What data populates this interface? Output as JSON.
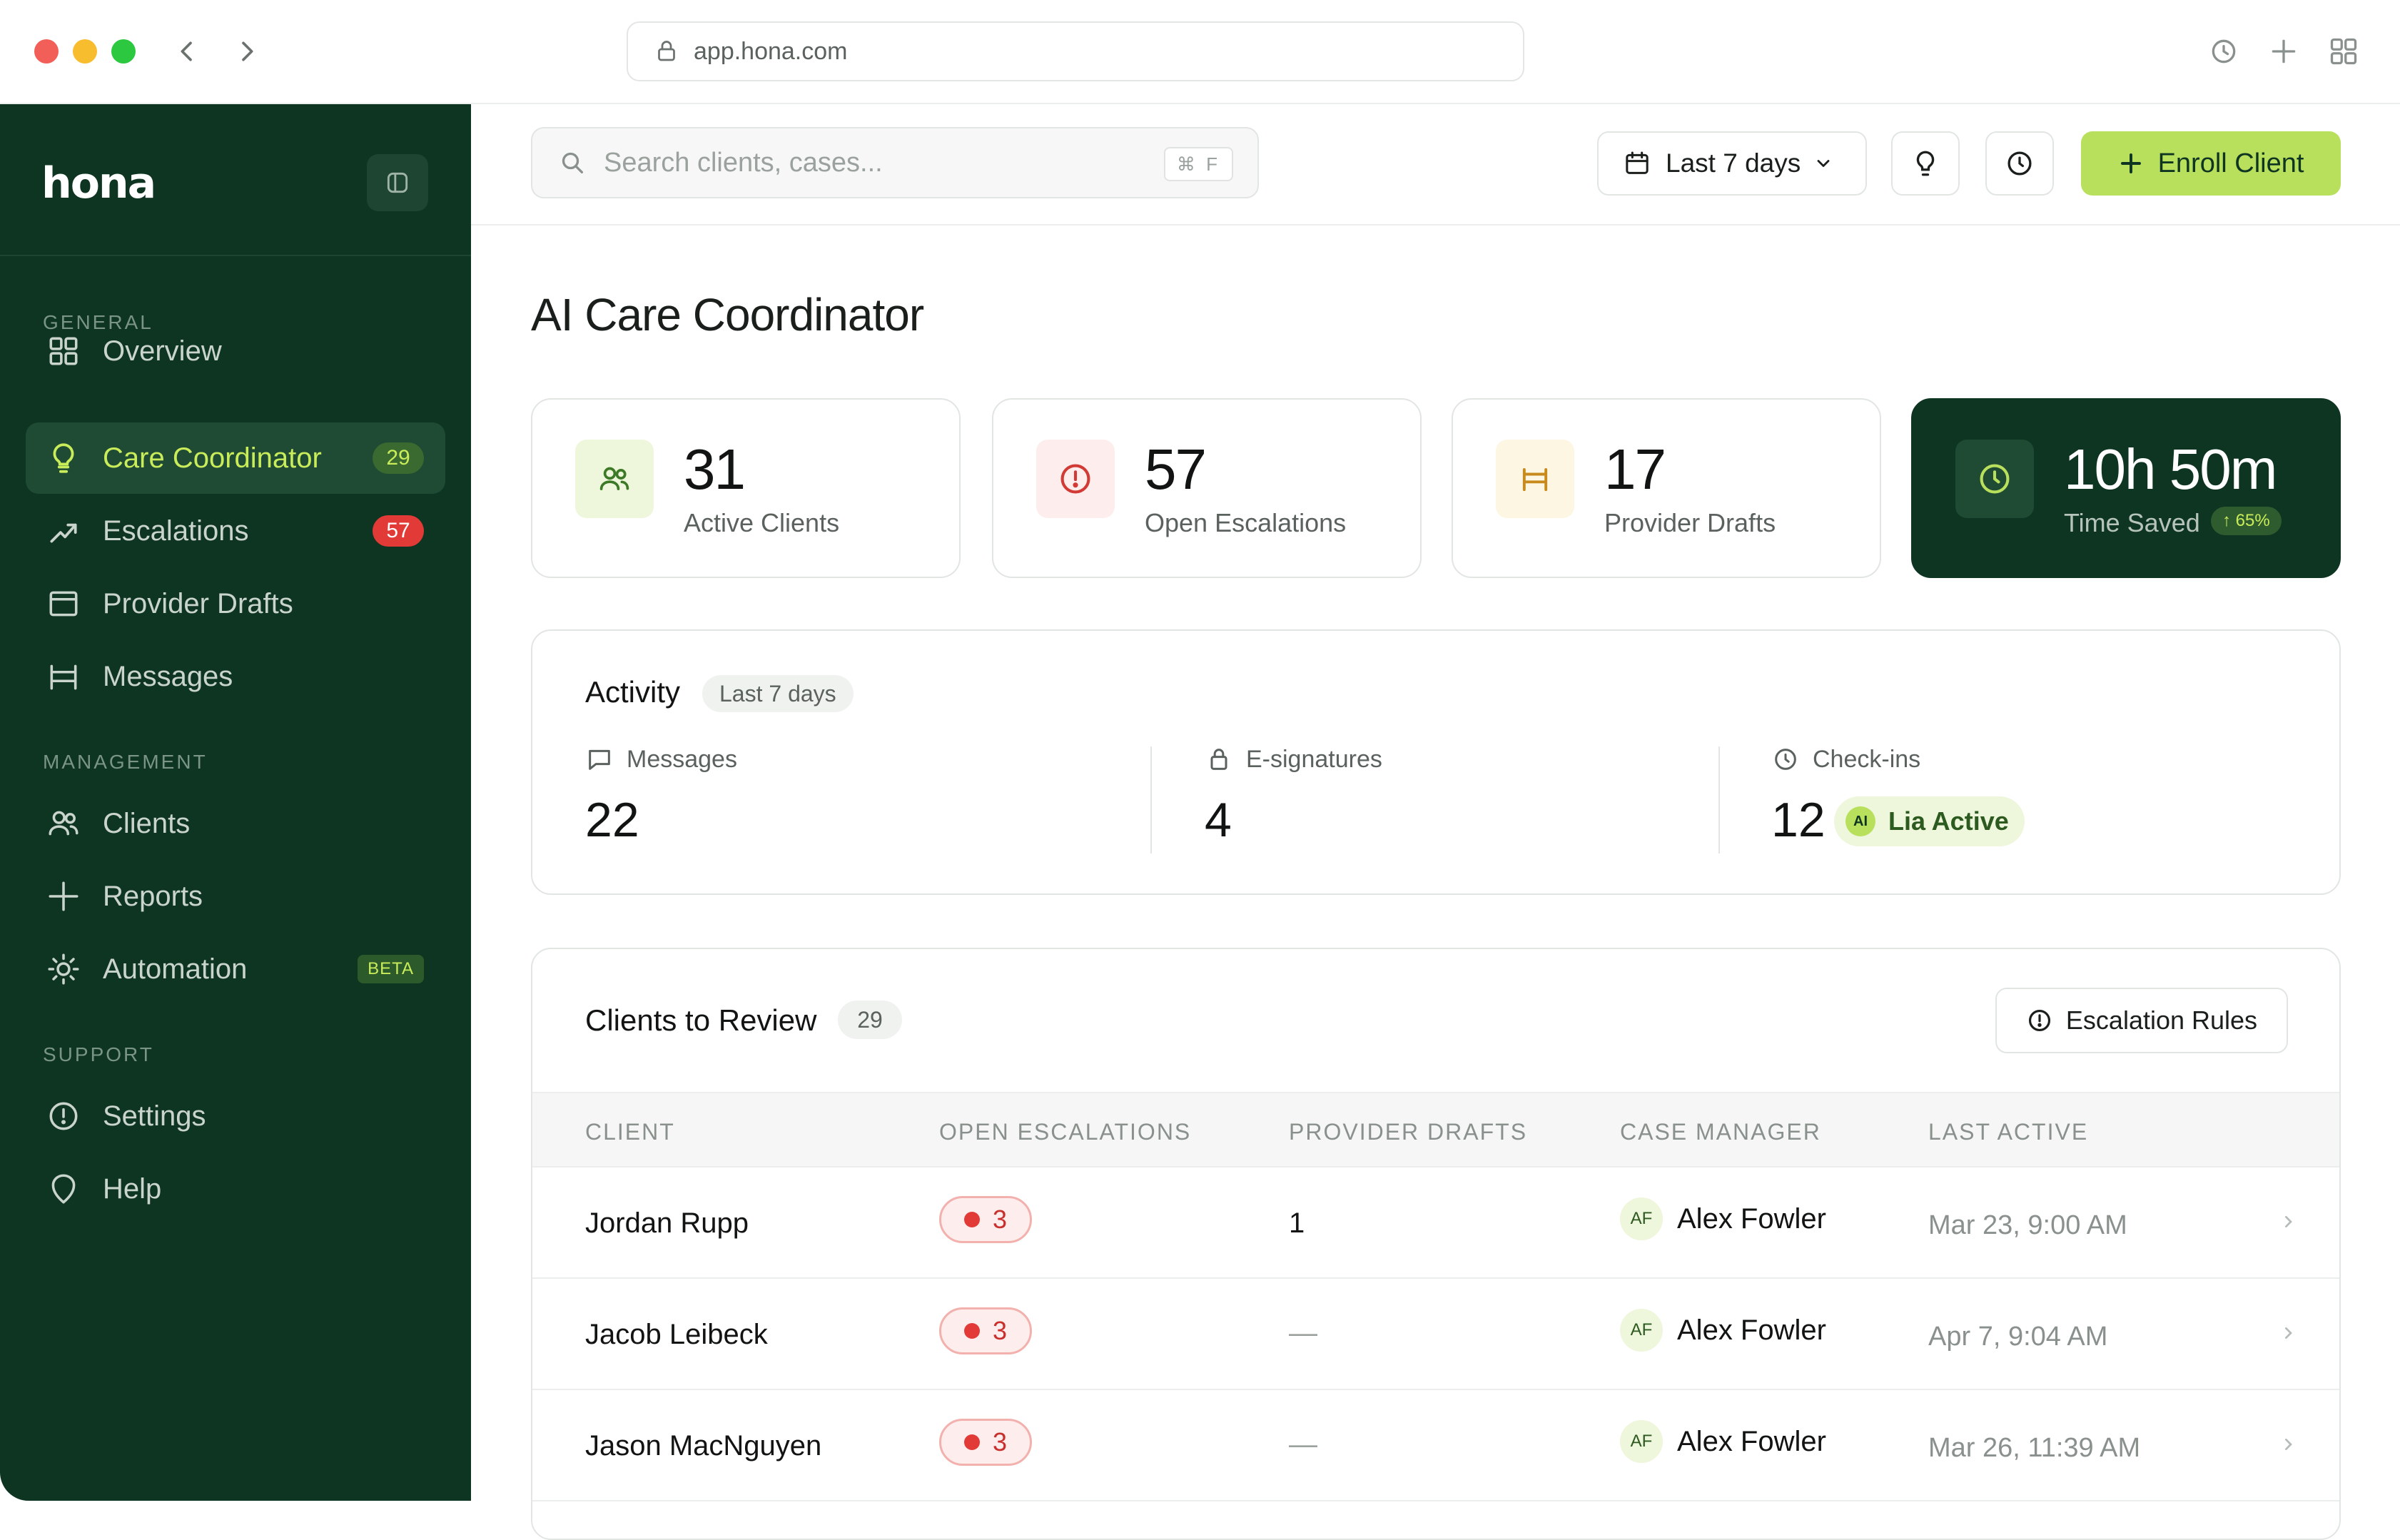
{
  "browser": {
    "url": "app.hona.com"
  },
  "sidebar": {
    "logo": "hona",
    "sections": {
      "general": "GENERAL",
      "management": "MANAGEMENT",
      "support": "SUPPORT"
    },
    "items": [
      {
        "label": "Overview",
        "icon": "grid-icon"
      },
      {
        "label": "Care Coordinator",
        "icon": "lightbulb-icon",
        "badge": "29",
        "active": true
      },
      {
        "label": "Escalations",
        "icon": "trend-icon",
        "badge": "57"
      },
      {
        "label": "Provider Drafts",
        "icon": "window-icon"
      },
      {
        "label": "Messages",
        "icon": "frame-icon"
      },
      {
        "label": "Clients",
        "icon": "users-icon"
      },
      {
        "label": "Reports",
        "icon": "plus-icon"
      },
      {
        "label": "Automation",
        "icon": "sun-icon",
        "badge": "BETA"
      },
      {
        "label": "Settings",
        "icon": "alert-circle-icon"
      },
      {
        "label": "Help",
        "icon": "shield-icon"
      }
    ]
  },
  "topbar": {
    "search_placeholder": "Search clients, cases...",
    "search_shortcut": "⌘ F",
    "range_label": "Last 7 days",
    "enroll_label": "Enroll Client"
  },
  "page": {
    "title": "AI Care Coordinator"
  },
  "stats": [
    {
      "value": "31",
      "label": "Active Clients",
      "icon": "users-icon"
    },
    {
      "value": "57",
      "label": "Open Escalations",
      "icon": "alert-circle-icon"
    },
    {
      "value": "17",
      "label": "Provider Drafts",
      "icon": "frame-icon"
    },
    {
      "value": "10h 50m",
      "label": "Time Saved",
      "icon": "clock-icon",
      "delta": "↑ 65%"
    }
  ],
  "activity": {
    "title": "Activity",
    "range": "Last 7 days",
    "messages_label": "Messages",
    "messages_value": "22",
    "esign_label": "E-signatures",
    "esign_value": "4",
    "checkins_label": "Check-ins",
    "checkins_value": "12",
    "lia_badge": "AI",
    "lia_label": "Lia Active"
  },
  "review": {
    "title": "Clients to Review",
    "count": "29",
    "rules_label": "Escalation Rules",
    "columns": [
      "CLIENT",
      "OPEN ESCALATIONS",
      "PROVIDER DRAFTS",
      "CASE MANAGER",
      "LAST ACTIVE"
    ],
    "rows": [
      {
        "client": "Jordan Rupp",
        "escalations": "3",
        "drafts": "1",
        "manager_initials": "AF",
        "manager": "Alex Fowler",
        "last_active": "Mar 23, 9:00 AM"
      },
      {
        "client": "Jacob Leibeck",
        "escalations": "3",
        "drafts": "—",
        "manager_initials": "AF",
        "manager": "Alex Fowler",
        "last_active": "Apr 7, 9:04 AM"
      },
      {
        "client": "Jason MacNguyen",
        "escalations": "3",
        "drafts": "—",
        "manager_initials": "AF",
        "manager": "Alex Fowler",
        "last_active": "Mar 26, 11:39 AM"
      }
    ]
  },
  "colors": {
    "sidebar_bg": "#0e3422",
    "accent": "#b9e05c",
    "danger": "#e23a36"
  }
}
